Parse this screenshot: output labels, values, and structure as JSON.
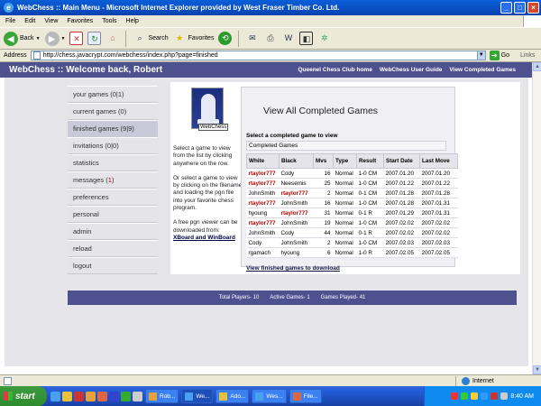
{
  "window": {
    "title": "WebChess :: Main Menu - Microsoft Internet Explorer provided by West Fraser Timber Co. Ltd."
  },
  "menu": [
    "File",
    "Edit",
    "View",
    "Favorites",
    "Tools",
    "Help"
  ],
  "toolbar": {
    "back": "Back",
    "search": "Search",
    "favorites": "Favorites"
  },
  "address": {
    "label": "Address",
    "url": "http://chess.javacrypt.com/webchess/index.php?page=finished",
    "go": "Go",
    "links": "Links"
  },
  "header": {
    "title": "WebChess :: Welcome back, Robert",
    "links": [
      "Queenel Chess Club home",
      "WebChess User Guide",
      "View Completed Games"
    ]
  },
  "sidebar": {
    "items": [
      {
        "label": "your games (0|1)"
      },
      {
        "label": "current games (0)"
      },
      {
        "label": "finished games (9|9)"
      },
      {
        "label": "invitations (0|0)"
      },
      {
        "label": "statistics"
      },
      {
        "label": "messages (",
        "count": "1",
        "suffix": ")"
      },
      {
        "label": "preferences"
      },
      {
        "label": "personal"
      },
      {
        "label": "admin"
      },
      {
        "label": "reload"
      },
      {
        "label": "logout"
      }
    ]
  },
  "logo": {
    "label": "WebChess"
  },
  "intro": {
    "p1": "Select a game to view from the list by clicking anywhere on the row.",
    "p2": "Or select a game to view by clicking on the filename and loading the pgn file into your favorite chess program.",
    "p3": "A free pgn viewer can be downloaded from:",
    "link": "XBoard and WinBoard"
  },
  "panel": {
    "title": "View All Completed Games",
    "subtitle": "Select a completed game to view",
    "caption": "Completed Games",
    "columns": [
      "White",
      "Black",
      "Mvs",
      "Type",
      "Result",
      "Start Date",
      "Last Move"
    ],
    "rows": [
      [
        "rtaylor777",
        "Cody",
        "16",
        "Normal",
        "1-0 CM",
        "2007.01.20",
        "2007.01.20"
      ],
      [
        "rtaylor777",
        "Neesemis",
        "25",
        "Normal",
        "1-0 CM",
        "2007.01.22",
        "2007.01.22"
      ],
      [
        "JohnSmith",
        "rtaylor777",
        "2",
        "Normal",
        "0-1 CM",
        "2007.01.28",
        "2007.01.28"
      ],
      [
        "rtaylor777",
        "JohnSmith",
        "16",
        "Normal",
        "1-0 CM",
        "2007.01.28",
        "2007.01.31"
      ],
      [
        "hyoung",
        "rtaylor777",
        "31",
        "Normal",
        "0-1 R",
        "2007.01.29",
        "2007.01.31"
      ],
      [
        "rtaylor777",
        "JohnSmith",
        "19",
        "Normal",
        "1-0 CM",
        "2007.02.02",
        "2007.02.02"
      ],
      [
        "JohnSmith",
        "Cody",
        "44",
        "Normal",
        "0-1 R",
        "2007.02.02",
        "2007.02.02"
      ],
      [
        "Cody",
        "JohnSmith",
        "2",
        "Normal",
        "1-0 CM",
        "2007.02.03",
        "2007.02.03"
      ],
      [
        "rgamach",
        "hyoung",
        "6",
        "Normal",
        "1-0 R",
        "2007.02.05",
        "2007.02.05"
      ]
    ],
    "download": "View finished games to download"
  },
  "footer": {
    "players": "Total Players- 10",
    "active": "Active Games- 1",
    "played": "Games Played- 41"
  },
  "status": {
    "zone": "Internet"
  },
  "taskbar": {
    "start": "start",
    "tasks": [
      "Rob...",
      "We...",
      "Ado...",
      "Wes...",
      "File..."
    ],
    "clock": "8:40 AM"
  },
  "colors": {
    "header": "#4d528e",
    "highlight": "#b00000",
    "start": "#3c9b3c"
  }
}
